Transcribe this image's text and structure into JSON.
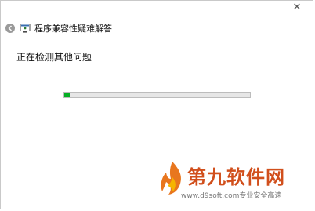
{
  "window": {
    "title": "程序兼容性疑难解答",
    "close_glyph": "✕"
  },
  "content": {
    "status": "正在检测其他问题",
    "progress": 0.03
  },
  "watermark": {
    "brand": "第九软件网",
    "tagline": "www.d9soft.com专业安全高速"
  },
  "colors": {
    "progress_fill": "#06b025",
    "progress_track": "#e6e6e6",
    "brand": "#d14f1c"
  },
  "icons": {
    "back": "back-arrow-icon",
    "app": "troubleshooter-icon",
    "close": "close-icon",
    "watermark_logo": "flame-logo-icon"
  }
}
